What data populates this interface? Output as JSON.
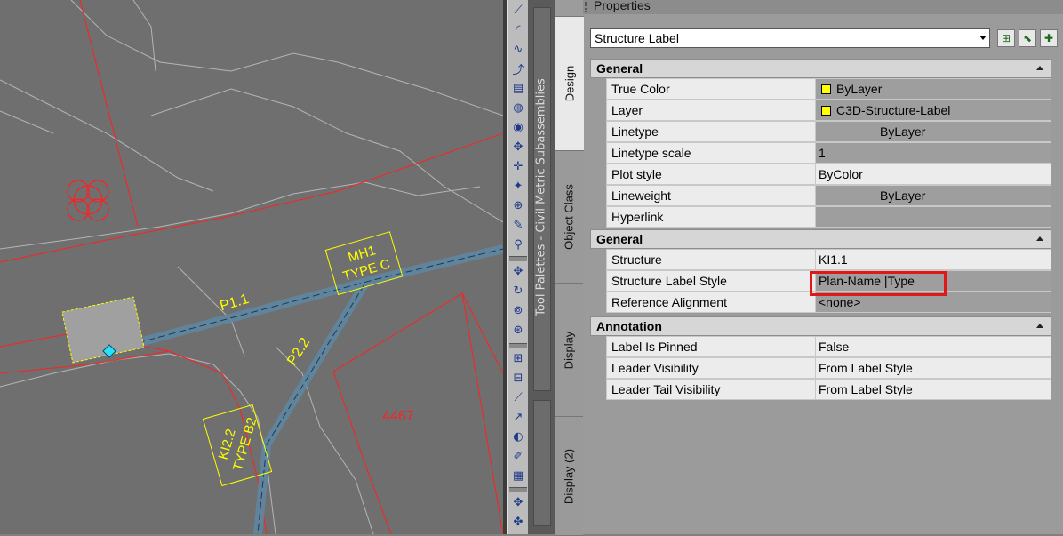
{
  "drawing": {
    "labels": [
      {
        "id": "mh1-line1",
        "text": "MH1"
      },
      {
        "id": "mh1-line2",
        "text": "TYPE C"
      },
      {
        "id": "ki22-line1",
        "text": "KI2.2"
      },
      {
        "id": "ki22-line2",
        "text": "TYPE B2"
      },
      {
        "id": "p11",
        "text": "P1.1"
      },
      {
        "id": "p22",
        "text": "P2.2"
      },
      {
        "id": "parcel",
        "text": "4467"
      }
    ],
    "colors": {
      "label": "#ffff00",
      "parcel_line": "#ff2020",
      "pipe": "#6a8faa",
      "background": "#6f6f6f"
    }
  },
  "toolbar": {
    "icons": [
      "line-tool-icon",
      "arc-tool-icon",
      "curve-tool-icon",
      "spiral-tool-icon",
      "document-tool-icon",
      "globe-tool-icon",
      "globe2-tool-icon",
      "compass-tool-icon",
      "crosshair-tool-icon",
      "snap-tool-icon",
      "target-tool-icon",
      "pencil-tool-icon",
      "pin-tool-icon",
      "node-tool-icon",
      "rotate-tool-icon",
      "target2-tool-icon",
      "target3-tool-icon",
      "grid-tool-icon",
      "grid2-tool-icon",
      "chart-tool-icon",
      "chart2-tool-icon",
      "arrow-tool-icon",
      "palette-tool-icon",
      "brush-tool-icon",
      "doc2-tool-icon",
      "move-tool-icon",
      "move2-tool-icon"
    ]
  },
  "tool_palette": {
    "title": "Tool Palettes - Civil Metric Subassemblies"
  },
  "side_tabs": [
    {
      "id": "design",
      "label": "Design",
      "active": true
    },
    {
      "id": "object-class",
      "label": "Object Class",
      "active": false
    },
    {
      "id": "display",
      "label": "Display",
      "active": false
    },
    {
      "id": "display-2",
      "label": "Display (2)",
      "active": false
    }
  ],
  "properties": {
    "title": "Properties",
    "object_type": "Structure Label",
    "header_buttons": [
      "quick-select-icon",
      "select-objects-icon",
      "toggle-pickadd-icon"
    ],
    "categories": [
      {
        "label": "General",
        "rows": [
          {
            "name": "True Color",
            "value": "ByLayer",
            "swatch": true,
            "editable": false
          },
          {
            "name": "Layer",
            "value": "C3D-Structure-Label",
            "swatch": true,
            "editable": false
          },
          {
            "name": "Linetype",
            "value": "ByLayer",
            "linetype": true,
            "editable": false
          },
          {
            "name": "Linetype scale",
            "value": "1",
            "editable": false
          },
          {
            "name": "Plot style",
            "value": "ByColor",
            "editable": true
          },
          {
            "name": "Lineweight",
            "value": "ByLayer",
            "linetype": true,
            "editable": false
          },
          {
            "name": "Hyperlink",
            "value": "",
            "editable": false
          }
        ]
      },
      {
        "label": "General",
        "rows": [
          {
            "name": "Structure",
            "value": "KI1.1",
            "editable": true
          },
          {
            "name": "Structure Label Style",
            "value": "Plan-Name |Type",
            "editable": false,
            "highlighted": true
          },
          {
            "name": "Reference Alignment",
            "value": "<none>",
            "editable": false
          }
        ]
      },
      {
        "label": "Annotation",
        "rows": [
          {
            "name": "Label Is Pinned",
            "value": "False",
            "editable": true
          },
          {
            "name": "Leader Visibility",
            "value": "From Label Style",
            "editable": true
          },
          {
            "name": "Leader Tail Visibility",
            "value": "From Label Style",
            "editable": true
          }
        ]
      }
    ]
  }
}
